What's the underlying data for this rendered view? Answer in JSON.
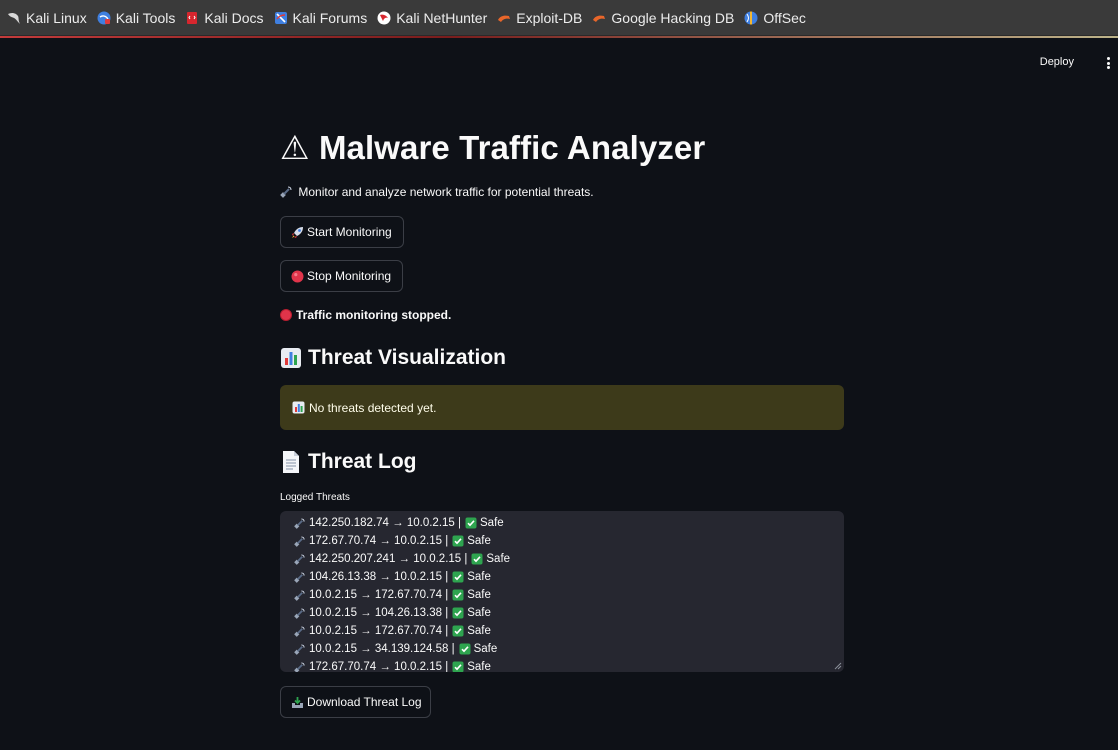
{
  "bookmarks": [
    {
      "label": "Kali Linux",
      "icon": "kali-dragon-icon"
    },
    {
      "label": "Kali Tools",
      "icon": "kali-tools-icon"
    },
    {
      "label": "Kali Docs",
      "icon": "kali-docs-icon"
    },
    {
      "label": "Kali Forums",
      "icon": "kali-forums-icon"
    },
    {
      "label": "Kali NetHunter",
      "icon": "kali-nethunter-icon"
    },
    {
      "label": "Exploit-DB",
      "icon": "exploit-db-icon"
    },
    {
      "label": "Google Hacking DB",
      "icon": "ghdb-icon"
    },
    {
      "label": "OffSec",
      "icon": "offsec-icon"
    }
  ],
  "header": {
    "deploy_label": "Deploy"
  },
  "main": {
    "title": "⚠ Malware Traffic Analyzer",
    "subtitle": "Monitor and analyze network traffic for potential threats.",
    "start_button": "Start Monitoring",
    "stop_button": "Stop Monitoring",
    "status_text": "Traffic monitoring stopped.",
    "viz_heading": "Threat Visualization",
    "viz_alert": "No threats detected yet.",
    "log_heading": "Threat Log",
    "log_label": "Logged Threats",
    "log_entries": [
      {
        "src": "142.250.182.74",
        "dst": "10.0.2.15",
        "status": "Safe"
      },
      {
        "src": "172.67.70.74",
        "dst": "10.0.2.15",
        "status": "Safe"
      },
      {
        "src": "142.250.207.241",
        "dst": "10.0.2.15",
        "status": "Safe"
      },
      {
        "src": "104.26.13.38",
        "dst": "10.0.2.15",
        "status": "Safe"
      },
      {
        "src": "10.0.2.15",
        "dst": "172.67.70.74",
        "status": "Safe"
      },
      {
        "src": "10.0.2.15",
        "dst": "104.26.13.38",
        "status": "Safe"
      },
      {
        "src": "10.0.2.15",
        "dst": "172.67.70.74",
        "status": "Safe"
      },
      {
        "src": "10.0.2.15",
        "dst": "34.139.124.58",
        "status": "Safe"
      },
      {
        "src": "172.67.70.74",
        "dst": "10.0.2.15",
        "status": "Safe"
      }
    ],
    "download_button": "Download Threat Log"
  },
  "colors": {
    "background": "#0e1117",
    "alert_bg": "#3d3a1a",
    "textarea_bg": "#262730",
    "status_red": "#e0344a",
    "check_green": "#2ea44f"
  }
}
